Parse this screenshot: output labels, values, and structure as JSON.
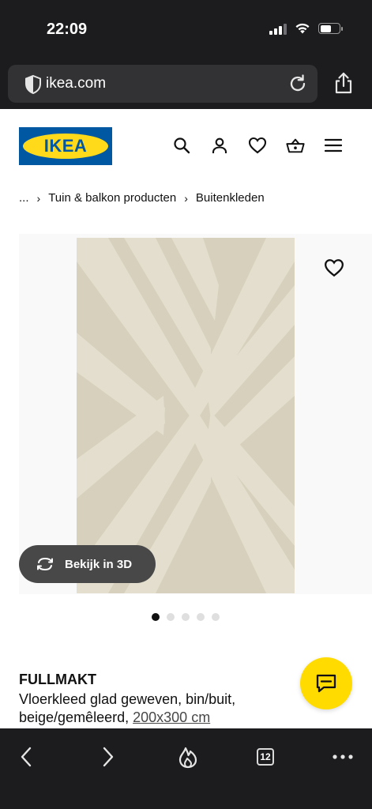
{
  "status_bar": {
    "time": "22:09"
  },
  "browser": {
    "url": "ikea.com",
    "tab_count": "12"
  },
  "brand": {
    "logo_text": "IKEA",
    "blue": "#0058a3",
    "yellow": "#ffda1a"
  },
  "header": {
    "icons": [
      "search-icon",
      "account-icon",
      "heart-icon",
      "basket-icon",
      "menu-icon"
    ]
  },
  "breadcrumb": {
    "ellipsis": "...",
    "items": [
      "Tuin & balkon producten",
      "Buitenkleden"
    ]
  },
  "product": {
    "view_3d_label": "Bekijk in 3D",
    "image_count": 5,
    "active_image": 1,
    "name": "FULLMAKT",
    "description": "Vloerkleed glad geweven, bin/buit, beige/gemêleerd,",
    "size": "200x300 cm"
  },
  "colors": {
    "chat_button": "#ffdb00",
    "chrome": "#1c1c1e"
  }
}
